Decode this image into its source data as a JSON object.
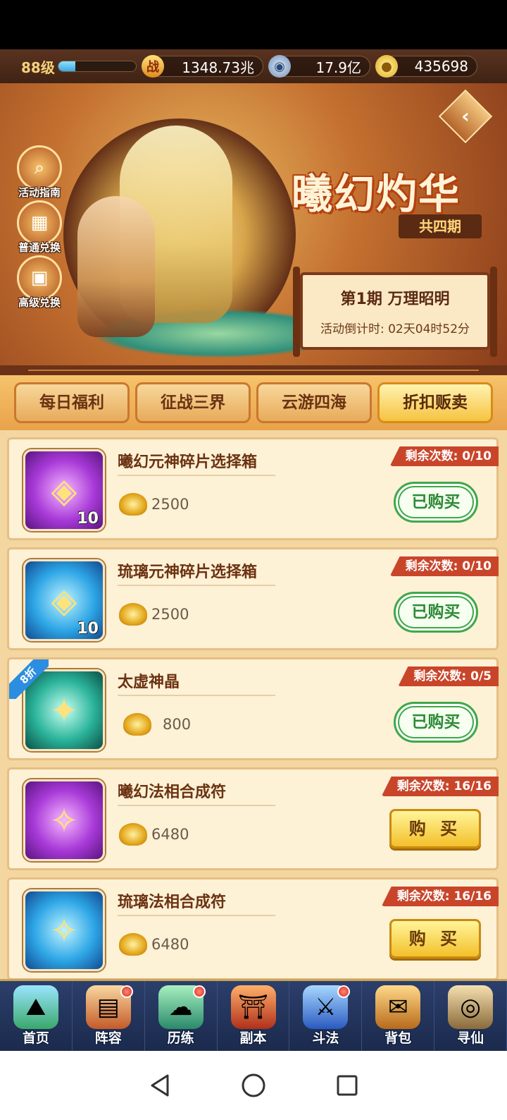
{
  "topbar": {
    "level": "88级",
    "xp_fraction": 0.22,
    "power_icon": "战",
    "power": "1348.73兆",
    "coins": "17.9亿",
    "ingots": "435698"
  },
  "banner": {
    "title": "曦幻灼华",
    "subtitle": "共四期",
    "period_title": "第1期  万理昭明",
    "countdown": "活动倒计时: 02天04时52分",
    "side_buttons": [
      {
        "label": "活动指南",
        "icon": "magnifier-icon"
      },
      {
        "label": "普通兑换",
        "icon": "chest-icon"
      },
      {
        "label": "高级兑换",
        "icon": "gift-icon"
      }
    ]
  },
  "tabs": [
    {
      "label": "每日福利",
      "active": false
    },
    {
      "label": "征战三界",
      "active": false
    },
    {
      "label": "云游四海",
      "active": false
    },
    {
      "label": "折扣贩卖",
      "active": true
    }
  ],
  "items": [
    {
      "name": "曦幻元神碎片选择箱",
      "price": "2500",
      "remaining": "剩余次数: 0/10",
      "button": "已购买",
      "bought": true,
      "count": "10",
      "discount": "",
      "theme": "purple"
    },
    {
      "name": "琉璃元神碎片选择箱",
      "price": "2500",
      "remaining": "剩余次数: 0/10",
      "button": "已购买",
      "bought": true,
      "count": "10",
      "discount": "",
      "theme": "blue"
    },
    {
      "name": "太虚神晶",
      "price": "800",
      "remaining": "剩余次数: 0/5",
      "button": "已购买",
      "bought": true,
      "count": "",
      "discount": "8折",
      "theme": "teal"
    },
    {
      "name": "曦幻法相合成符",
      "price": "6480",
      "remaining": "剩余次数: 16/16",
      "button": "购 买",
      "bought": false,
      "count": "",
      "discount": "",
      "theme": "purple"
    },
    {
      "name": "琉璃法相合成符",
      "price": "6480",
      "remaining": "剩余次数: 16/16",
      "button": "购 买",
      "bought": false,
      "count": "",
      "discount": "",
      "theme": "blue"
    }
  ],
  "bottom_nav": [
    {
      "label": "首页",
      "icon": "home-icon",
      "dot": false
    },
    {
      "label": "阵容",
      "icon": "team-icon",
      "dot": true
    },
    {
      "label": "历练",
      "icon": "train-icon",
      "dot": true
    },
    {
      "label": "副本",
      "icon": "dungeon-icon",
      "dot": false
    },
    {
      "label": "斗法",
      "icon": "fight-icon",
      "dot": true
    },
    {
      "label": "背包",
      "icon": "bag-icon",
      "dot": false
    },
    {
      "label": "寻仙",
      "icon": "seek-icon",
      "dot": false
    }
  ]
}
